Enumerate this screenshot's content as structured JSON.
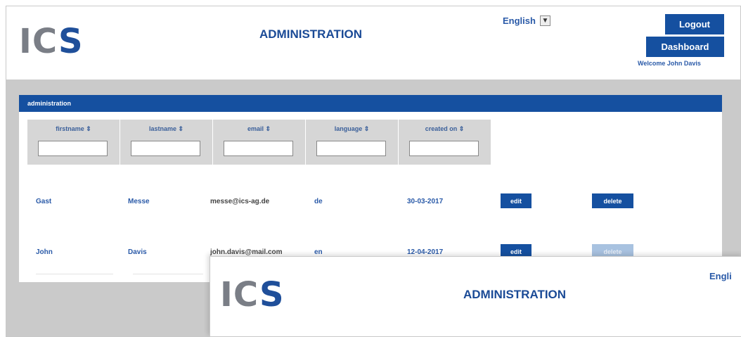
{
  "header": {
    "logo": "ICS",
    "title": "ADMINISTRATION",
    "language": "English",
    "logout_label": "Logout",
    "dashboard_label": "Dashboard",
    "welcome": "Welcome John Davis"
  },
  "panel": {
    "title": "administration",
    "columns": [
      {
        "label": "firstname",
        "sort_icon": "sort-icon"
      },
      {
        "label": "lastname",
        "sort_icon": "sort-icon"
      },
      {
        "label": "email",
        "sort_icon": "sort-icon"
      },
      {
        "label": "language",
        "sort_icon": "sort-icon"
      },
      {
        "label": "created on",
        "sort_icon": "sort-icon"
      }
    ],
    "rows": [
      {
        "firstname": "Gast",
        "lastname": "Messe",
        "email": "messe@ics-ag.de",
        "language": "de",
        "created_on": "30-03-2017",
        "edit": "edit",
        "delete": "delete",
        "delete_enabled": true
      },
      {
        "firstname": "John",
        "lastname": "Davis",
        "email": "john.davis@mail.com",
        "language": "en",
        "created_on": "12-04-2017",
        "edit": "edit",
        "delete": "delete",
        "delete_enabled": false
      }
    ]
  },
  "overlay": {
    "logo": "ICS",
    "title": "ADMINISTRATION",
    "language": "Engli"
  },
  "colors": {
    "brand_blue": "#1550a0",
    "link_blue": "#2a5aa8",
    "logo_gray": "#7a7e86",
    "background_gray": "#cacaca"
  }
}
